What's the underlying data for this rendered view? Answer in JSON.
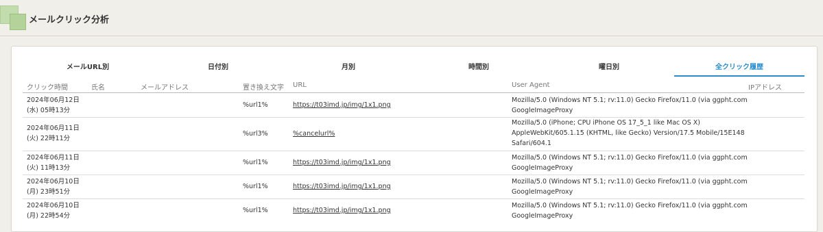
{
  "page": {
    "title": "メールクリック分析"
  },
  "tabs": [
    {
      "label": "メールURL別"
    },
    {
      "label": "日付別"
    },
    {
      "label": "月別"
    },
    {
      "label": "時間別"
    },
    {
      "label": "曜日別"
    },
    {
      "label": "全クリック履歴",
      "active": true
    }
  ],
  "columns": {
    "click_time": "クリック時間",
    "name": "氏名",
    "email": "メールアドレス",
    "replace": "置き換え文字",
    "url": "URL",
    "user_agent": "User Agent",
    "ip": "IPアドレス"
  },
  "rows": [
    {
      "date": "2024年06月12日",
      "time": "(水) 05時13分",
      "replace": "%url1%",
      "url": "https://t03imd.jp/img/1x1.png",
      "ua": [
        "Mozilla/5.0 (Windows NT 5.1; rv:11.0) Gecko Firefox/11.0 (via ggpht.com",
        "GoogleImageProxy"
      ]
    },
    {
      "date": "2024年06月11日",
      "time": "(火) 22時11分",
      "replace": "%url3%",
      "url": "%cancelurl%",
      "ua": [
        "Mozilla/5.0 (iPhone; CPU iPhone OS 17_5_1 like Mac OS X)",
        "AppleWebKit/605.1.15 (KHTML, like Gecko) Version/17.5 Mobile/15E148",
        "Safari/604.1"
      ]
    },
    {
      "date": "2024年06月11日",
      "time": "(火) 11時13分",
      "replace": "%url1%",
      "url": "https://t03imd.jp/img/1x1.png",
      "ua": [
        "Mozilla/5.0 (Windows NT 5.1; rv:11.0) Gecko Firefox/11.0 (via ggpht.com",
        "GoogleImageProxy"
      ]
    },
    {
      "date": "2024年06月10日",
      "time": "(月) 23時51分",
      "replace": "%url1%",
      "url": "https://t03imd.jp/img/1x1.png",
      "ua": [
        "Mozilla/5.0 (Windows NT 5.1; rv:11.0) Gecko Firefox/11.0 (via ggpht.com",
        "GoogleImageProxy"
      ]
    },
    {
      "date": "2024年06月10日",
      "time": "(月) 22時54分",
      "replace": "%url1%",
      "url": "https://t03imd.jp/img/1x1.png",
      "ua": [
        "Mozilla/5.0 (Windows NT 5.1; rv:11.0) Gecko Firefox/11.0 (via ggpht.com",
        "GoogleImageProxy"
      ]
    }
  ]
}
